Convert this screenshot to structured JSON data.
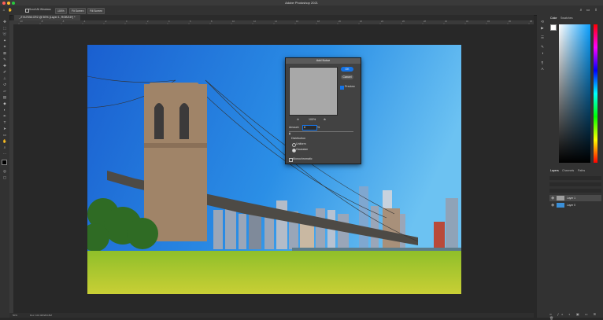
{
  "app": {
    "title": "Adobe Photoshop 2021"
  },
  "options_bar": {
    "scroll_all_windows": "Scroll All Windows",
    "zoom": "100%",
    "fit_screen": "Fit Screen",
    "fill_screen": "Fill Screen"
  },
  "document": {
    "tab_label": "_Z7A7536.CR2 @ 50% (Layer 1, RGB/16*) *"
  },
  "ruler_ticks": [
    "-10",
    "-8",
    "-6",
    "-4",
    "-2",
    "0",
    "2",
    "4",
    "6",
    "8",
    "10",
    "12",
    "14",
    "16",
    "18",
    "20",
    "22",
    "24",
    "26",
    "28",
    "30",
    "32",
    "34",
    "36",
    "38"
  ],
  "status": {
    "zoom": "50%",
    "doc": "Doc: 102.4M/204.8M"
  },
  "add_noise": {
    "title": "Add Noise",
    "ok": "OK",
    "cancel": "Cancel",
    "preview_label": "Preview",
    "preview_zoom": "100%",
    "amount_label": "Amount:",
    "amount_value": "8",
    "amount_unit": "%",
    "distribution_label": "Distribution",
    "uniform": "Uniform",
    "gaussian": "Gaussian",
    "monochromatic": "Monochromatic"
  },
  "panels": {
    "color_tab": "Color",
    "swatches_tab": "Swatches",
    "layers_tab": "Layers",
    "channels_tab": "Channels",
    "paths_tab": "Paths",
    "layers": [
      {
        "name": "Layer 1"
      },
      {
        "name": "Layer 0"
      }
    ]
  },
  "colors": {
    "accent": "#1473e6",
    "ui_dark": "#323232",
    "canvas_bg": "#282828"
  }
}
